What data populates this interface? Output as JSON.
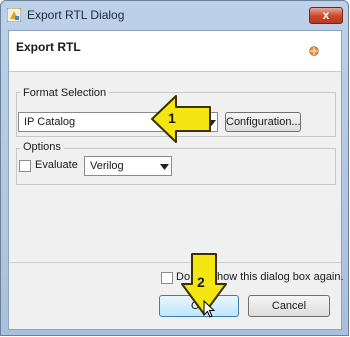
{
  "window": {
    "title": "Export RTL Dialog",
    "close_label": "x"
  },
  "header": {
    "title": "Export RTL"
  },
  "format_selection": {
    "group_label": "Format Selection",
    "format_value": "IP Catalog",
    "configuration_label": "Configuration..."
  },
  "options": {
    "group_label": "Options",
    "evaluate_label": "Evaluate",
    "evaluate_checked": false,
    "language_value": "Verilog"
  },
  "footer": {
    "dont_show_label": "Do not show this dialog box again.",
    "dont_show_checked": false,
    "ok_label": "OK",
    "cancel_label": "Cancel"
  },
  "annotations": {
    "step1_number": "1",
    "step2_number": "2",
    "color": "#f5e612"
  }
}
